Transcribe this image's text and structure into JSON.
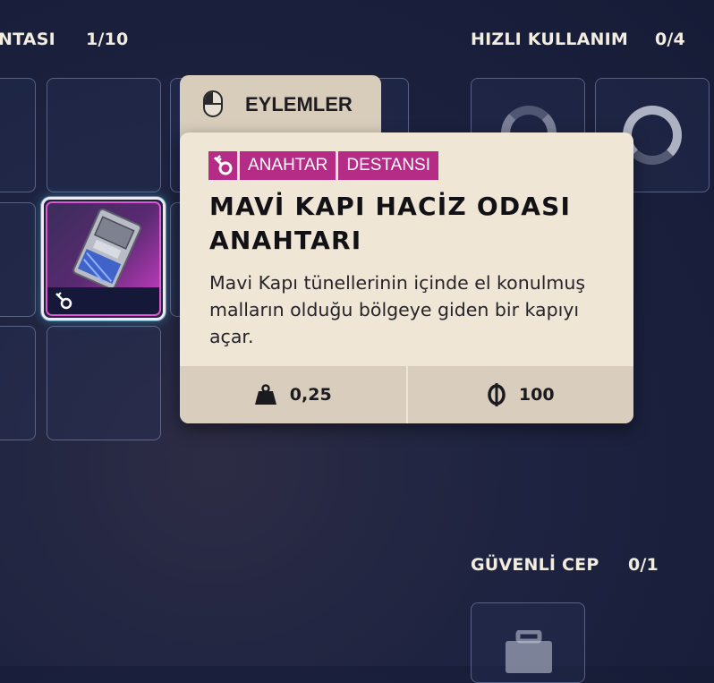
{
  "inventory": {
    "title_partial": "NTASI",
    "count": "1/10"
  },
  "quick_use": {
    "title": "HIZLI KULLANIM",
    "count": "0/4"
  },
  "safe_pocket": {
    "title": "GÜVENLİ CEP",
    "count": "0/1"
  },
  "actions_tab": {
    "label": "EYLEMLER",
    "icon": "mouse-icon"
  },
  "tooltip": {
    "tags": [
      "ANAHTAR",
      "DESTANSI"
    ],
    "tag_icon": "key-icon",
    "title": "MAVİ KAPI HACİZ ODASI ANAHTARI",
    "description": "Mavi Kapı tünellerinin içinde el konulmuş malların olduğu bölgeye giden bir kapıyı açar.",
    "weight": "0,25",
    "value": "100",
    "weight_icon": "weight-icon",
    "currency_icon": "coin-icon"
  },
  "colors": {
    "tag_bg": "#b42c86",
    "tooltip_bg": "#efe6d6",
    "stats_bg": "#d9cebd",
    "rarity": "#e056d0"
  }
}
